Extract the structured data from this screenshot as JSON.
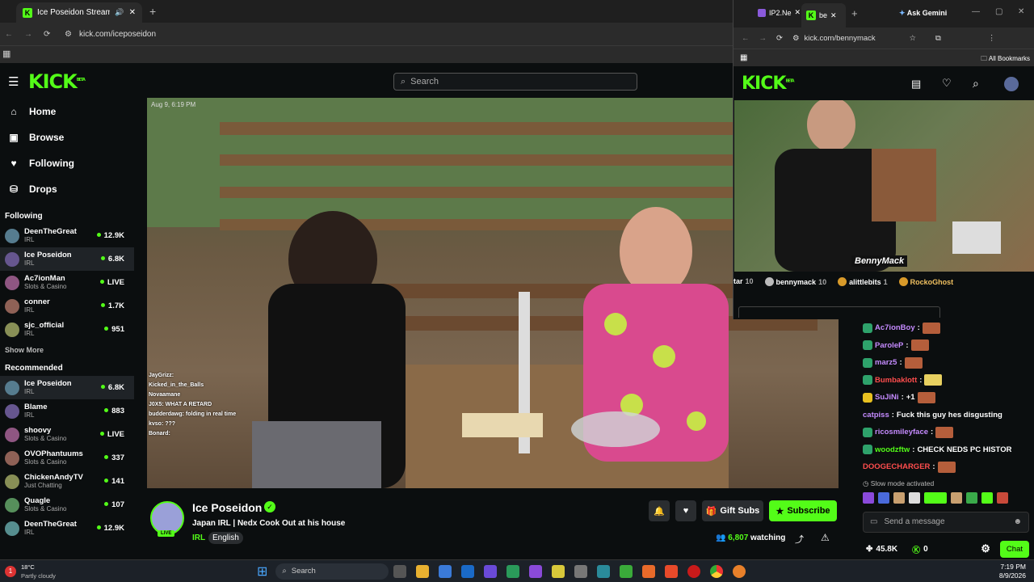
{
  "main_browser": {
    "tab_title": "Ice Poseidon Stream - Wat",
    "url": "kick.com/iceposeidon"
  },
  "header": {
    "logo": "KICK",
    "logo_sup": "BETA",
    "search_placeholder": "Search"
  },
  "sidebar": {
    "nav": [
      {
        "label": "Home",
        "icon": "home-icon"
      },
      {
        "label": "Browse",
        "icon": "browse-icon"
      },
      {
        "label": "Following",
        "icon": "heart-icon"
      },
      {
        "label": "Drops",
        "icon": "drops-icon"
      }
    ],
    "following_title": "Following",
    "following": [
      {
        "name": "DeenTheGreat",
        "category": "IRL",
        "viewers": "12.9K"
      },
      {
        "name": "Ice Poseidon",
        "category": "IRL",
        "viewers": "6.8K"
      },
      {
        "name": "Ac7ionMan",
        "category": "Slots & Casino",
        "viewers": "LIVE"
      },
      {
        "name": "conner",
        "category": "IRL",
        "viewers": "1.7K"
      },
      {
        "name": "sjc_official",
        "category": "IRL",
        "viewers": "951"
      }
    ],
    "show_more": "Show More",
    "recommended_title": "Recommended",
    "recommended": [
      {
        "name": "Ice Poseidon",
        "category": "IRL",
        "viewers": "6.8K"
      },
      {
        "name": "Blame",
        "category": "IRL",
        "viewers": "883"
      },
      {
        "name": "shoovy",
        "category": "Slots & Casino",
        "viewers": "LIVE"
      },
      {
        "name": "OVOPhantuums",
        "category": "Slots & Casino",
        "viewers": "337"
      },
      {
        "name": "ChickenAndyTV",
        "category": "Just Chatting",
        "viewers": "141"
      },
      {
        "name": "Quagle",
        "category": "Slots & Casino",
        "viewers": "107"
      },
      {
        "name": "DeenTheGreat",
        "category": "IRL",
        "viewers": "12.9K"
      }
    ]
  },
  "video": {
    "timestamp": "Aug 9, 6:19 PM",
    "overlay_chat": [
      "JayGrizz:",
      "Kicked_in_the_Balls",
      "Novaamane",
      "J0X5: WHAT A RETARD",
      "budderdawg: folding in real time",
      "kvso: ???",
      "Bonard:"
    ]
  },
  "stream_info": {
    "streamer": "Ice Poseidon",
    "live_badge": "LIVE",
    "title": "Japan IRL | Nedx Cook Out at his house",
    "category": "IRL",
    "language": "English",
    "viewers": "6,807",
    "watching_label": "watching",
    "gift_subs": "Gift Subs",
    "subscribe": "Subscribe"
  },
  "second_window": {
    "tab1": "IP2.Ne",
    "tab2": "be",
    "ask_gemini": "Ask Gemini",
    "url": "kick.com/bennymack",
    "all_bookmarks": "All Bookmarks",
    "overlay_name": "BennyMack",
    "gifters": [
      {
        "name": "tar",
        "count": "10"
      },
      {
        "name": "bennymack",
        "count": "10"
      },
      {
        "name": "alittlebits",
        "count": "1"
      },
      {
        "name": "RockoGhost",
        "count": ""
      }
    ]
  },
  "chat": {
    "messages": [
      {
        "user": "Ac7ionBoy",
        "color": "#c58bff",
        "text": ""
      },
      {
        "user": "ParoleP",
        "color": "#c58bff",
        "text": ""
      },
      {
        "user": "marz5",
        "color": "#c58bff",
        "text": ""
      },
      {
        "user": "Bumbaklott",
        "color": "#ff4d4d",
        "text": ""
      },
      {
        "user": "SuJiNi",
        "color": "#c58bff",
        "text": "+1"
      },
      {
        "user": "catpiss",
        "color": "#c58bff",
        "text": "Fuck this guy hes disgusting"
      },
      {
        "user": "ricosmileyface",
        "color": "#c58bff",
        "text": ""
      },
      {
        "user": "woodzftw",
        "color": "#53fc18",
        "text": "CHECK NEDS PC HISTOR"
      },
      {
        "user": "DOOGECHARGER",
        "color": "#ff4d4d",
        "text": ""
      }
    ],
    "slow_mode": "Slow mode activated",
    "input_placeholder": "Send a message",
    "kicks": "45.8K",
    "points": "0",
    "chat_button": "Chat"
  },
  "taskbar": {
    "temp": "18°C",
    "weather": "Partly cloudy",
    "search": "Search",
    "time": "7:19 PM",
    "date": "8/9/2026",
    "notification_count": "1"
  }
}
